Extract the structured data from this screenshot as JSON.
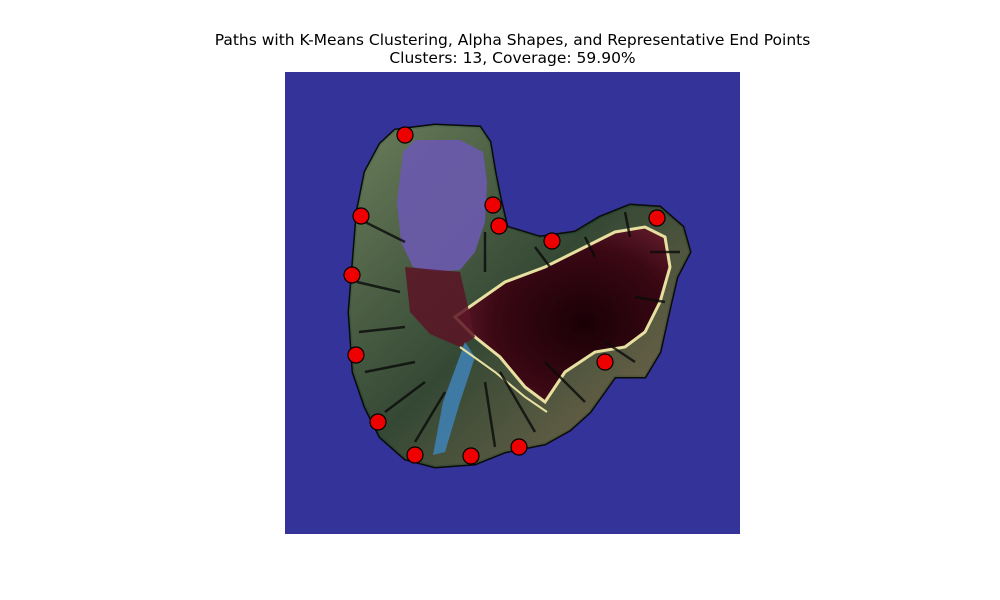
{
  "chart_data": {
    "type": "scatter",
    "title": "Paths with K-Means Clustering, Alpha Shapes, and Representative End Points",
    "subtitle": "Clusters: 13, Coverage: 59.90%",
    "xlim": [
      0,
      455
    ],
    "ylim": [
      0,
      462
    ],
    "background_color": "#333399",
    "marker_color": "#ee0000",
    "marker_edge_color": "#000000",
    "end_points": [
      {
        "x": 120,
        "y": 63
      },
      {
        "x": 76,
        "y": 144
      },
      {
        "x": 67,
        "y": 203
      },
      {
        "x": 71,
        "y": 283
      },
      {
        "x": 93,
        "y": 350
      },
      {
        "x": 130,
        "y": 383
      },
      {
        "x": 186,
        "y": 384
      },
      {
        "x": 234,
        "y": 375
      },
      {
        "x": 208,
        "y": 133
      },
      {
        "x": 214,
        "y": 154
      },
      {
        "x": 267,
        "y": 169
      },
      {
        "x": 372,
        "y": 146
      },
      {
        "x": 320,
        "y": 290
      }
    ]
  }
}
